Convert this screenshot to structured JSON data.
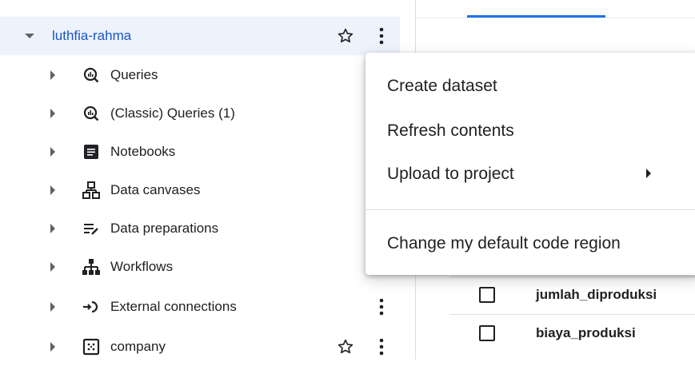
{
  "explorer": {
    "project": {
      "name": "luthfia-rahma"
    },
    "items": [
      {
        "label": "Queries",
        "icon": "query-icon"
      },
      {
        "label": "(Classic) Queries (1)",
        "icon": "classic-query-icon"
      },
      {
        "label": "Notebooks",
        "icon": "notebook-icon"
      },
      {
        "label": "Data canvases",
        "icon": "data-canvas-icon"
      },
      {
        "label": "Data preparations",
        "icon": "data-preparation-icon"
      },
      {
        "label": "Workflows",
        "icon": "workflow-icon"
      },
      {
        "label": "External connections",
        "icon": "external-connection-icon"
      },
      {
        "label": "company",
        "icon": "dataset-icon"
      }
    ]
  },
  "context_menu": {
    "items": [
      {
        "label": "Create dataset"
      },
      {
        "label": "Refresh contents"
      },
      {
        "label": "Upload to project"
      },
      {
        "label": "Change my default code region"
      }
    ]
  },
  "schema_table": {
    "rows": [
      {
        "field": "jumlah_diproduksi"
      },
      {
        "field": "biaya_produksi"
      }
    ]
  },
  "colors": {
    "accent": "#1a73e8",
    "selected_row": "#edf2fb",
    "project_text": "#1a57c8"
  }
}
